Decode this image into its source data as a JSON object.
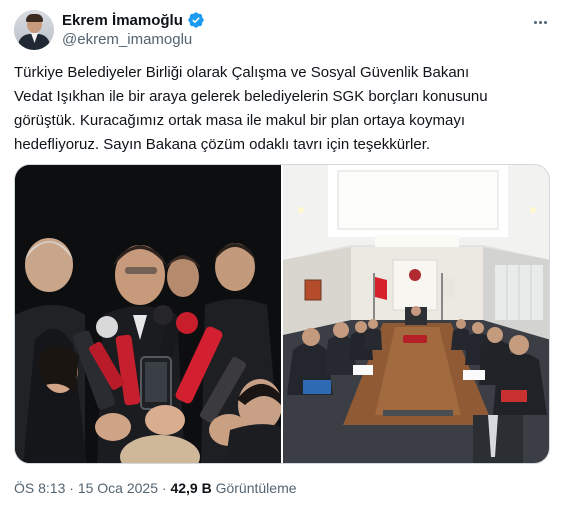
{
  "author": {
    "display_name": "Ekrem İmamoğlu",
    "handle": "@ekrem_imamoglu",
    "verified_color": "#1d9bf0"
  },
  "tweet": {
    "lines": [
      "Türkiye Belediyeler Birliği olarak Çalışma ve Sosyal Güvenlik Bakanı",
      "Vedat Işıkhan ile bir araya gelerek belediyelerin SGK borçları konusunu",
      "görüştük. Kuracağımız ortak masa ile makul bir plan ortaya koymayı",
      "hedefliyoruz. Sayın Bakana çözüm odaklı tavrı için teşekkürler."
    ]
  },
  "meta": {
    "time": "ÖS 8:13",
    "separator": "·",
    "date": "15 Oca 2025",
    "views_count": "42,9 B",
    "views_label": "Görüntüleme"
  },
  "icons": {
    "avatar": "profile-photo",
    "verified": "verified-badge-icon",
    "more": "more-options-icon"
  }
}
